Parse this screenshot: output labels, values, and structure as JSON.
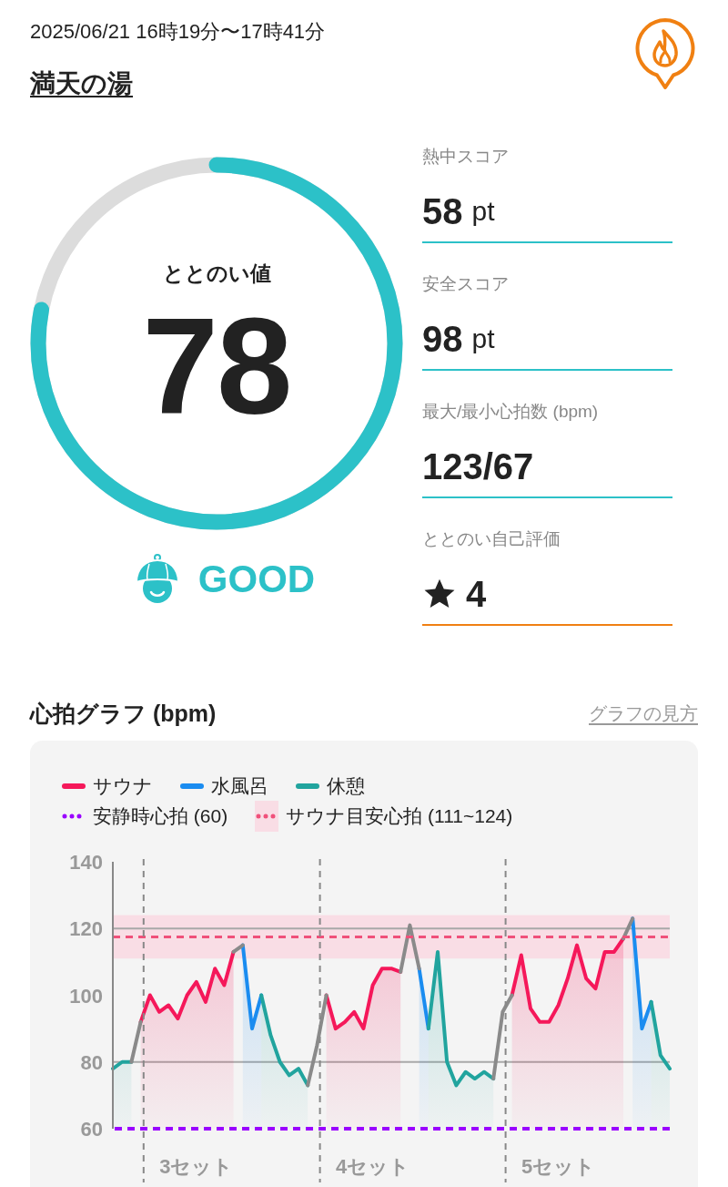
{
  "header": {
    "datetime": "2025/06/21 16時19分〜17時41分",
    "facility": "満天の湯"
  },
  "score_gauge": {
    "label": "ととのい値",
    "value": "78",
    "level": 0.78
  },
  "status": {
    "label": "GOOD"
  },
  "metrics": [
    {
      "kind": "score",
      "label": "熱中スコア",
      "value": "58",
      "unit": "pt"
    },
    {
      "kind": "score",
      "label": "安全スコア",
      "value": "98",
      "unit": "pt"
    },
    {
      "kind": "plain",
      "label": "最大/最小心拍数 (bpm)",
      "value": "123/67"
    },
    {
      "kind": "rating",
      "label": "ととのい自己評価",
      "value": "4"
    }
  ],
  "heart_chart": {
    "title": "心拍グラフ (bpm)",
    "guide_link": "グラフの見方",
    "chart_data": {
      "type": "area",
      "categories": [
        null,
        null,
        null,
        null,
        null,
        null,
        null,
        null,
        null,
        "3セット",
        null,
        null,
        null,
        null,
        null,
        null,
        null,
        null,
        null,
        null,
        null,
        null,
        null,
        null,
        null,
        null,
        null,
        null,
        "4セット",
        null,
        null,
        null,
        null,
        null,
        null,
        null,
        null,
        null,
        null,
        null,
        null,
        null,
        null,
        null,
        null,
        null,
        null,
        null,
        "5セット",
        null,
        null,
        null,
        null,
        null,
        null,
        null,
        null,
        null,
        null,
        null,
        null
      ],
      "ylim": [
        60,
        140
      ],
      "yticks": [
        60,
        80,
        100,
        120,
        140
      ],
      "series": [
        {
          "name": "サウナ",
          "color": "#f5185a",
          "values": [
            null,
            null,
            null,
            92,
            100,
            95,
            97,
            93,
            100,
            104,
            98,
            108,
            103,
            113,
            null,
            null,
            null,
            null,
            null,
            null,
            null,
            null,
            null,
            100,
            90,
            92,
            95,
            90,
            103,
            108,
            108,
            107,
            null,
            null,
            null,
            null,
            null,
            null,
            null,
            null,
            null,
            null,
            null,
            100,
            112,
            96,
            92,
            92,
            97,
            105,
            115,
            105,
            102,
            113,
            113,
            117,
            null,
            null,
            null,
            null,
            null
          ]
        },
        {
          "name": "水風呂",
          "color": "#1a8cf0",
          "values": [
            null,
            null,
            null,
            null,
            null,
            null,
            null,
            null,
            null,
            null,
            null,
            null,
            null,
            null,
            115,
            90,
            100,
            null,
            null,
            null,
            null,
            null,
            null,
            null,
            null,
            null,
            null,
            null,
            null,
            null,
            null,
            null,
            null,
            108,
            90,
            null,
            null,
            null,
            null,
            null,
            null,
            null,
            null,
            null,
            null,
            null,
            null,
            null,
            null,
            null,
            null,
            null,
            null,
            null,
            null,
            null,
            123,
            90,
            98,
            null,
            null
          ]
        },
        {
          "name": "休憩",
          "color": "#21a49e",
          "values": [
            78,
            80,
            80,
            null,
            null,
            null,
            null,
            null,
            null,
            null,
            null,
            null,
            null,
            null,
            null,
            null,
            100,
            88,
            80,
            76,
            78,
            73,
            null,
            null,
            null,
            null,
            null,
            null,
            null,
            null,
            null,
            null,
            null,
            null,
            90,
            113,
            80,
            73,
            77,
            75,
            77,
            75,
            null,
            null,
            null,
            null,
            null,
            null,
            null,
            null,
            null,
            null,
            null,
            null,
            null,
            null,
            null,
            null,
            98,
            82,
            78
          ]
        },
        {
          "type": "line",
          "color": "#8a8a8a",
          "values": [
            null,
            null,
            80,
            92,
            null,
            null,
            null,
            null,
            null,
            null,
            null,
            null,
            null,
            113,
            115,
            null,
            null,
            null,
            null,
            null,
            null,
            73,
            85,
            100,
            null,
            null,
            null,
            null,
            null,
            null,
            null,
            107,
            121,
            108,
            null,
            null,
            null,
            null,
            null,
            null,
            null,
            75,
            95,
            100,
            null,
            null,
            null,
            null,
            null,
            null,
            null,
            null,
            null,
            null,
            null,
            117,
            123,
            null,
            null,
            null,
            null
          ]
        }
      ],
      "ref_lines": [
        {
          "axis": "y",
          "value": 80,
          "color": "#a8a8a8"
        },
        {
          "axis": "y",
          "value": 120,
          "color": "#a8a8a8"
        },
        {
          "axis": "y",
          "value": 117.5,
          "color": "#f0507a"
        },
        {
          "axis": "y",
          "value": 60,
          "color": "#9a00ff",
          "label": "安静時心拍 (60)"
        }
      ],
      "bands": [
        {
          "axis": "y",
          "from": 111,
          "to": 124,
          "color": "#f9dde5",
          "label": "サウナ目安心拍 (111~124)"
        }
      ]
    }
  }
}
